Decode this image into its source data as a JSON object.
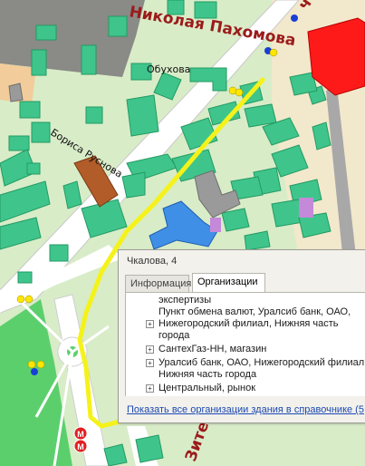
{
  "map": {
    "streets": {
      "main_street": "Николая Пахомова",
      "main_street_prefix": "ч",
      "side_street": "Бориса Руснова",
      "lower_street": "Зите",
      "small_label": "Обухова"
    },
    "metro_icon": "metro-icon",
    "colors": {
      "park": "#d8ecc8",
      "building": "#3fc58c",
      "road": "#ffffff",
      "route": "#f5f21a",
      "highlight_red": "#ff1a1a",
      "highlight_blue": "#3f8fe6",
      "highlight_brown": "#b25c2a"
    }
  },
  "popup": {
    "title": "Чкалова, 4",
    "tabs": [
      {
        "label": "Информация",
        "active": false
      },
      {
        "label": "Организации",
        "active": true
      }
    ],
    "items": [
      {
        "text": "экспертизы",
        "expandable": false
      },
      {
        "text": "Пункт обмена валют, Уралсиб банк, ОАО,",
        "expandable": false
      },
      {
        "text": "Нижегородский филиал, Нижняя часть",
        "expandable": true
      },
      {
        "text": "города",
        "expandable": false
      },
      {
        "text": "СантехГаз-НН, магазин",
        "expandable": true
      },
      {
        "text": "Уралсиб банк, ОАО, Нижегородский филиал,",
        "expandable": true
      },
      {
        "text": "Нижняя часть города",
        "expandable": false
      },
      {
        "text": "Центральный, рынок",
        "expandable": true
      }
    ],
    "link": "Показать все организации здания в справочнике (5"
  }
}
